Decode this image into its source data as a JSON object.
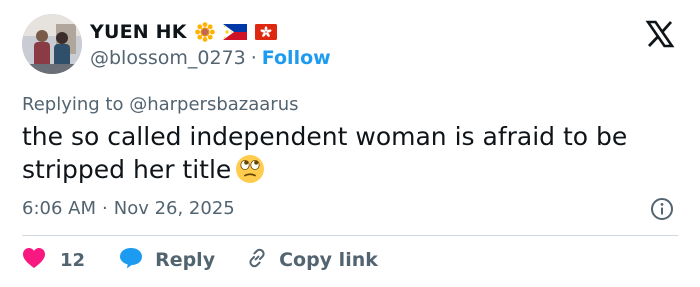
{
  "author": {
    "display_name": "YUEN HK",
    "handle": "@blossom_0273",
    "separator": "·",
    "follow_label": "Follow",
    "badges": [
      "sunflower-emoji",
      "philippines-flag-emoji",
      "hong-kong-flag-emoji"
    ]
  },
  "reply": {
    "prefix": "Replying to",
    "mention": "@harpersbazaarus"
  },
  "tweet": {
    "text": "the so called independent woman is afraid to be stripped her title",
    "emoji": "face-with-rolling-eyes"
  },
  "meta": {
    "time": "6:06 AM",
    "separator": "·",
    "date": "Nov 26, 2025"
  },
  "actions": {
    "like_count": "12",
    "reply_label": "Reply",
    "copy_link_label": "Copy link"
  },
  "colors": {
    "accent": "#1d9bf0",
    "like": "#f91880",
    "text_secondary": "#536471",
    "text_primary": "#0f1419",
    "divider": "#cfd9de"
  },
  "icons": [
    "avatar-photo",
    "x-logo-icon",
    "info-icon",
    "heart-icon",
    "reply-bubble-icon",
    "link-icon"
  ]
}
